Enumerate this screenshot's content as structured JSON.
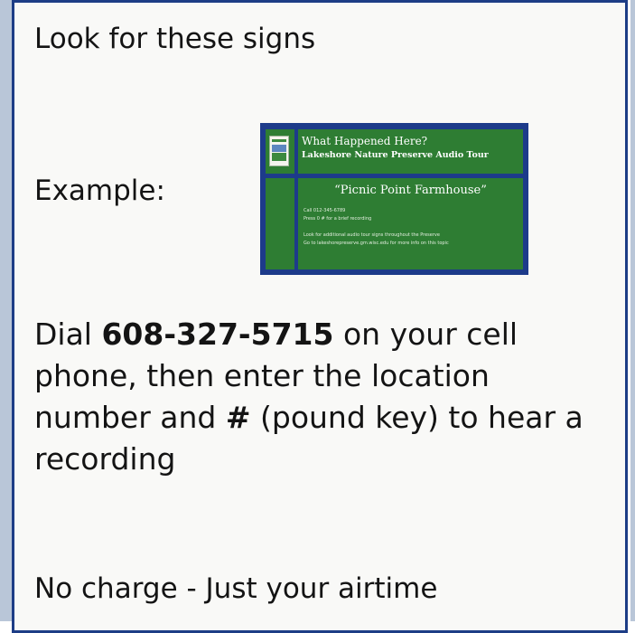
{
  "heading": "Look for these signs",
  "example_label": "Example:",
  "sign": {
    "title": "What Happened Here?",
    "subtitle": "Lakeshore Nature Preserve Audio Tour",
    "location": "“Picnic Point Farmhouse”",
    "lines": [
      "Call 012-345-6789",
      "Press 0 # for a brief recording",
      "Look for additional audio tour signs throughout the Preserve",
      "Go to lakeshorepreserve.gm.wisc.edu for more info on this topic"
    ],
    "colors": {
      "frame": "#1d3b8a",
      "panel": "#2e7d33",
      "text": "#ffffff"
    }
  },
  "instructions": {
    "part1": "Dial ",
    "phone": "608-327-5715",
    "part2": " on your cell phone, then enter the location number and ",
    "key": "#",
    "part3": " (pound key) to hear a recording"
  },
  "note": "No charge - Just your airtime",
  "colors": {
    "border": "#1d3d86",
    "edge": "#b9c6d8",
    "background": "#f9f9f7",
    "text": "#141414"
  }
}
